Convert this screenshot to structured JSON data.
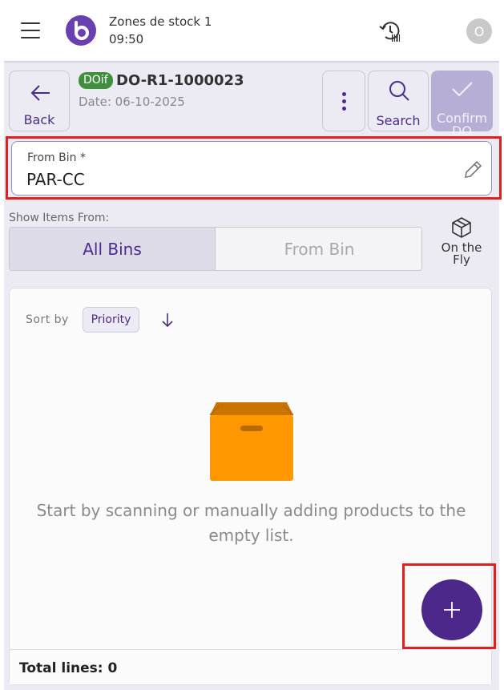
{
  "header": {
    "app_title": "Zones de stock 1",
    "time": "09:50",
    "avatar_initial": "O"
  },
  "toolbar": {
    "back_label": "Back",
    "doc_badge": "DOif",
    "doc_number": "DO-R1-1000023",
    "doc_date": "Date: 06-10-2025",
    "search_label": "Search",
    "confirm_label": "Confirm DO"
  },
  "from_bin": {
    "label": "From Bin *",
    "value": "PAR-CC"
  },
  "show_items": {
    "label": "Show Items From:",
    "options": [
      "All Bins",
      "From Bin"
    ],
    "selected": "All Bins",
    "on_the_fly_label": "On the Fly"
  },
  "list": {
    "sort_label": "Sort by",
    "sort_value": "Priority",
    "empty_message": "Start by scanning or manually adding products to the empty list.",
    "total_lines": "Total lines: 0"
  },
  "colors": {
    "primary": "#4b2889",
    "badge_green": "#3f8f3d",
    "highlight_red": "#e01f1f",
    "box_orange": "#ff9800"
  }
}
